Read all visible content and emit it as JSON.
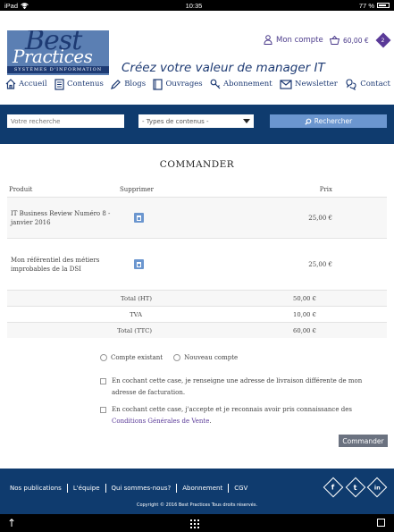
{
  "status": {
    "device": "iPad",
    "time": "10:35",
    "battery": "77 %",
    "battery_fraction": 0.77
  },
  "header": {
    "logo_best": "Best",
    "logo_practices": "Practices",
    "logo_sub": "SYSTÈMES D'INFORMATION",
    "account_label": "Mon compte",
    "cart_total": "60,00 €",
    "cart_count": "2",
    "tagline": "Créez votre valeur de manager IT"
  },
  "nav": {
    "items": [
      {
        "label": "Accueil",
        "icon": "home-icon"
      },
      {
        "label": "Contenus",
        "icon": "document-icon"
      },
      {
        "label": "Blogs",
        "icon": "blog-icon"
      },
      {
        "label": "Ouvrages",
        "icon": "book-icon"
      },
      {
        "label": "Abonnement",
        "icon": "key-icon"
      },
      {
        "label": "Newsletter",
        "icon": "envelope-icon"
      },
      {
        "label": "Contact",
        "icon": "contact-icon"
      }
    ]
  },
  "search": {
    "placeholder": "Votre recherche",
    "type_selected": "- Types de contenus -",
    "button_label": "Rechercher"
  },
  "page": {
    "title": "COMMANDER"
  },
  "table": {
    "headers": {
      "product": "Produit",
      "delete": "Supprimer",
      "price": "Prix"
    },
    "items": [
      {
        "product": "IT Business Review Numéro 8 - janvier 2016",
        "price": "25,00 €"
      },
      {
        "product": "Mon référentiel des métiers improbables de la DSI",
        "price": "25,00 €"
      }
    ],
    "totals": [
      {
        "label": "Total (HT)",
        "value": "50,00 €"
      },
      {
        "label": "TVA",
        "value": "10,00 €"
      },
      {
        "label": "Total (TTC)",
        "value": "60,00 €"
      }
    ]
  },
  "options": {
    "existing_account": "Compte existant",
    "new_account": "Nouveau compte",
    "delivery_check": "En cochant cette case, je renseigne une adresse de livraison différente de mon adresse de facturation.",
    "cgv_prefix": "En cochant cette case, j'accepte et je reconnais avoir pris connaissance des",
    "cgv_link": "Conditions Générales de Vente",
    "cgv_suffix": "."
  },
  "order_button": "Commander",
  "footer": {
    "links": [
      "Nos publications",
      "L'équipe",
      "Qui sommes-nous?",
      "Abonnement",
      "CGV"
    ],
    "social": [
      "f",
      "t",
      "in"
    ],
    "copyright": "Copyright © 2016 Best Practices Tous droits réservés."
  }
}
